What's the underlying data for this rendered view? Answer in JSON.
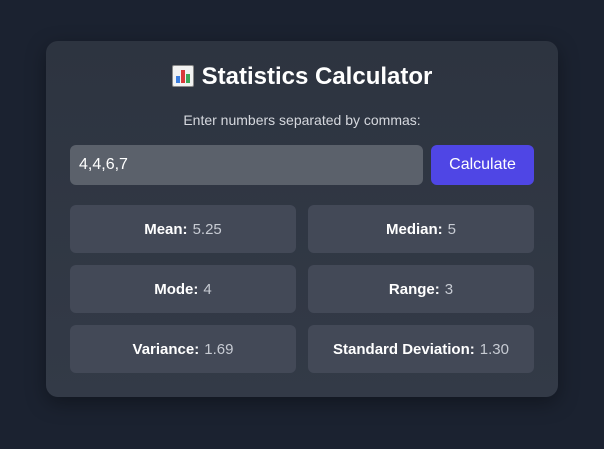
{
  "header": {
    "icon": "bar-chart-icon",
    "title": "Statistics Calculator",
    "subtitle": "Enter numbers separated by commas:"
  },
  "input": {
    "value": "4,4,6,7"
  },
  "button": {
    "label": "Calculate",
    "color": "#4f46e5"
  },
  "results": [
    {
      "label": "Mean:",
      "value": "5.25"
    },
    {
      "label": "Median:",
      "value": "5"
    },
    {
      "label": "Mode:",
      "value": "4"
    },
    {
      "label": "Range:",
      "value": "3"
    },
    {
      "label": "Variance:",
      "value": "1.69"
    },
    {
      "label": "Standard Deviation:",
      "value": "1.30"
    }
  ]
}
